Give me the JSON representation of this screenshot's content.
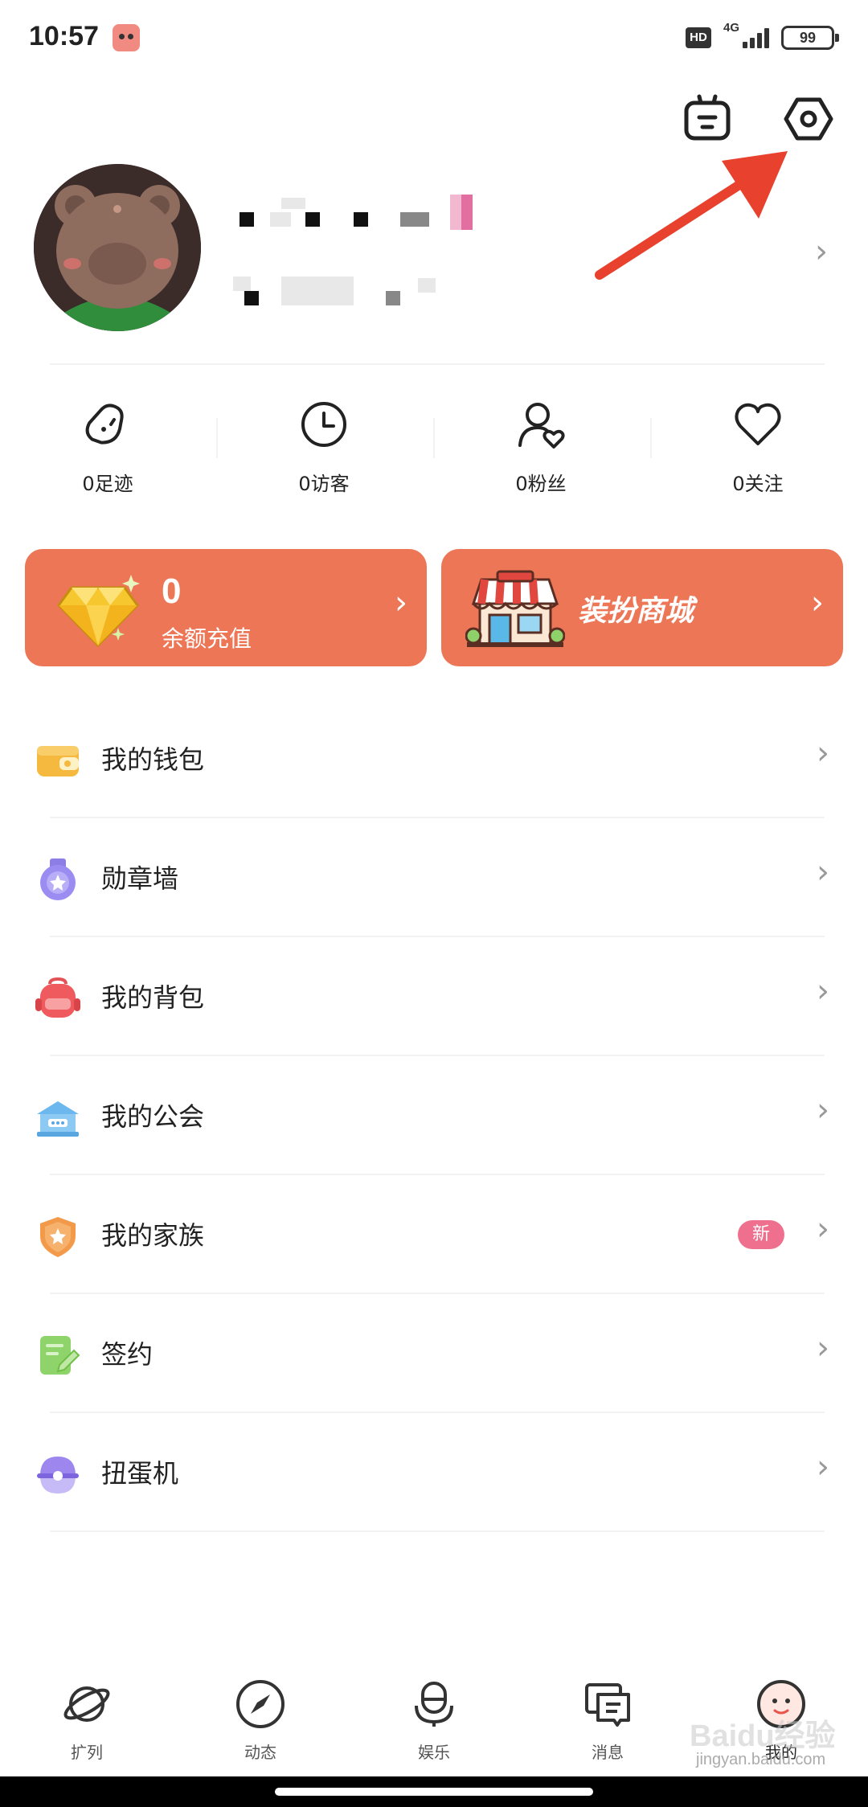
{
  "status_bar": {
    "time": "10:57",
    "hd": "HD",
    "network": "4G",
    "battery": "99"
  },
  "header": {
    "icons": [
      "robot-icon",
      "settings-icon"
    ]
  },
  "profile": {
    "name": "",
    "id": ""
  },
  "stats": [
    {
      "label": "0足迹",
      "icon": "footprint-icon"
    },
    {
      "label": "0访客",
      "icon": "clock-icon"
    },
    {
      "label": "0粉丝",
      "icon": "fans-icon"
    },
    {
      "label": "0关注",
      "icon": "heart-icon"
    }
  ],
  "cards": {
    "balance": {
      "value": "0",
      "label": "余额充值",
      "icon": "diamond-icon"
    },
    "shop": {
      "label": "装扮商城",
      "icon": "store-icon"
    }
  },
  "menu": [
    {
      "label": "我的钱包",
      "icon": "wallet-icon"
    },
    {
      "label": "勋章墙",
      "icon": "medal-icon"
    },
    {
      "label": "我的背包",
      "icon": "backpack-icon"
    },
    {
      "label": "我的公会",
      "icon": "guild-icon"
    },
    {
      "label": "我的家族",
      "icon": "family-shield-icon",
      "badge": "新"
    },
    {
      "label": "签约",
      "icon": "contract-icon"
    },
    {
      "label": "扭蛋机",
      "icon": "gacha-icon"
    }
  ],
  "bottom_nav": [
    {
      "label": "扩列",
      "icon": "planet-icon"
    },
    {
      "label": "动态",
      "icon": "compass-icon"
    },
    {
      "label": "娱乐",
      "icon": "microphone-icon"
    },
    {
      "label": "消息",
      "icon": "message-icon"
    },
    {
      "label": "我的",
      "icon": "profile-face-icon",
      "active": true
    }
  ],
  "watermark": {
    "brand": "Baidu经验",
    "url": "jingyan.baidu.com"
  },
  "colors": {
    "card": "#ed7657",
    "badge": "#ef6f8e",
    "arrow": "#e8412e"
  }
}
